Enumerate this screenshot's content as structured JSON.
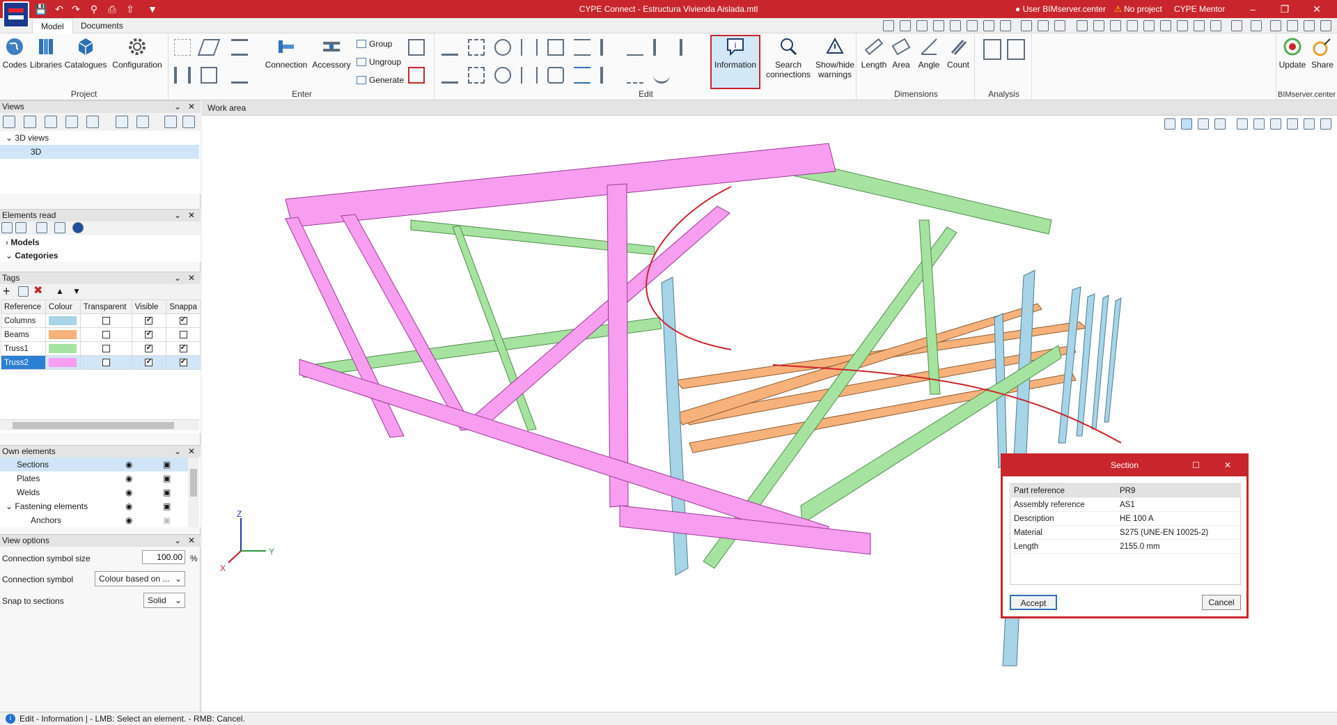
{
  "titlebar": {
    "title": "CYPE Connect - Estructura Vivienda Aislada.mtl",
    "user": "User BIMserver.center",
    "project": "No project",
    "mentor": "CYPE Mentor"
  },
  "tabs": [
    "Model",
    "Documents"
  ],
  "ribbon": {
    "project": {
      "label": "Project",
      "buttons": [
        "Codes",
        "Libraries",
        "Catalogues",
        "Configuration"
      ]
    },
    "enter": {
      "label": "Enter",
      "buttons": [
        "Connection",
        "Accessory"
      ],
      "small": [
        "Group",
        "Ungroup",
        "Generate"
      ]
    },
    "edit": {
      "label": "Edit",
      "information": "Information",
      "search": "Search connections",
      "warnings": "Show/hide warnings"
    },
    "dimensions": {
      "label": "Dimensions",
      "buttons": [
        "Length",
        "Area",
        "Angle",
        "Count"
      ]
    },
    "analysis": {
      "label": "Analysis"
    },
    "bim": {
      "label": "BIMserver.center",
      "buttons": [
        "Update",
        "Share"
      ]
    }
  },
  "views": {
    "title": "Views",
    "tree_root": "3D views",
    "tree_item": "3D"
  },
  "elements_read": {
    "title": "Elements read",
    "items": [
      "Models",
      "Categories"
    ]
  },
  "tags": {
    "title": "Tags",
    "headers": [
      "Reference",
      "Colour",
      "Transparent",
      "Visible",
      "Snappa"
    ],
    "rows": [
      {
        "ref": "Columns",
        "color": "#a7d4e6",
        "transparent": false,
        "visible": true,
        "snap": true
      },
      {
        "ref": "Beams",
        "color": "#f7b27b",
        "transparent": false,
        "visible": true,
        "snap": false
      },
      {
        "ref": "Truss1",
        "color": "#a6e3a0",
        "transparent": false,
        "visible": true,
        "snap": true
      },
      {
        "ref": "Truss2",
        "color": "#f79ef0",
        "transparent": false,
        "visible": true,
        "snap": true
      }
    ]
  },
  "own_elements": {
    "title": "Own elements",
    "items": [
      "Sections",
      "Plates",
      "Welds",
      "Fastening elements",
      "Anchors"
    ]
  },
  "view_options": {
    "title": "View options",
    "symbol_size_label": "Connection symbol size",
    "symbol_size": "100.00",
    "unit": "%",
    "symbol_label": "Connection symbol",
    "symbol_value": "Colour based on ...",
    "snap_label": "Snap to sections",
    "snap_value": "Solid"
  },
  "work_area": {
    "title": "Work area",
    "axes": {
      "z": "Z",
      "x": "X",
      "y": "Y"
    }
  },
  "dialog": {
    "title": "Section",
    "props": [
      {
        "k": "Part reference",
        "v": "PR9"
      },
      {
        "k": "Assembly reference",
        "v": "AS1"
      },
      {
        "k": "Description",
        "v": "HE 100 A"
      },
      {
        "k": "Material",
        "v": "S275 (UNE-EN 10025-2)"
      },
      {
        "k": "Length",
        "v": "2155.0 mm"
      }
    ],
    "accept": "Accept",
    "cancel": "Cancel"
  },
  "status": {
    "text": "Edit - Information  |  - LMB: Select an element. - RMB: Cancel."
  },
  "colors": {
    "columns": "#a7d4e6",
    "beams": "#f7b27b",
    "truss1": "#a6e3a0",
    "truss2": "#f79ef0",
    "accent": "#c8262c"
  }
}
